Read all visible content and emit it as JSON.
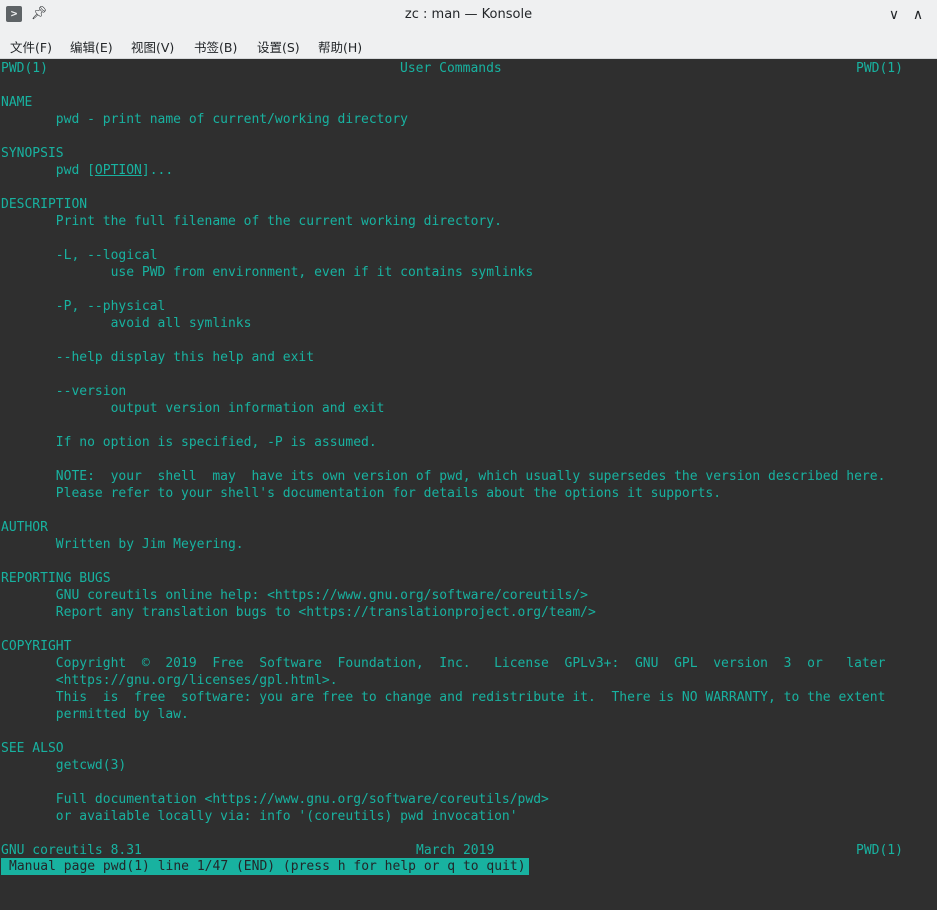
{
  "window": {
    "title": "zc : man — Konsole",
    "app_icon": "terminal-icon",
    "pin_icon": "pin-icon",
    "minimize_icon": "chevron-down-icon",
    "maximize_icon": "chevron-up-icon",
    "close_icon": "close-icon"
  },
  "menu": {
    "file": "文件(F)",
    "edit": "编辑(E)",
    "view": "视图(V)",
    "bookmarks": "书签(B)",
    "settings": "设置(S)",
    "help": "帮助(H)"
  },
  "manpage": {
    "header_left": "PWD(1)",
    "header_center": "User Commands",
    "header_right": "PWD(1)",
    "footer_left": "GNU coreutils 8.31",
    "footer_center": "March 2019",
    "footer_right": "PWD(1)",
    "status": "Manual page pwd(1) line 1/47 (END) (press h for help or q to quit)",
    "synopsis_pre": "       pwd [",
    "synopsis_opt": "OPTION",
    "synopsis_post": "]...",
    "lines": [
      "NAME",
      "       pwd - print name of current/working directory",
      "",
      "SYNOPSIS",
      "",
      "",
      "DESCRIPTION",
      "       Print the full filename of the current working directory.",
      "",
      "       -L, --logical",
      "              use PWD from environment, even if it contains symlinks",
      "",
      "       -P, --physical",
      "              avoid all symlinks",
      "",
      "       --help display this help and exit",
      "",
      "       --version",
      "              output version information and exit",
      "",
      "       If no option is specified, -P is assumed.",
      "",
      "       NOTE:  your  shell  may  have its own version of pwd, which usually supersedes the version described here.",
      "       Please refer to your shell's documentation for details about the options it supports.",
      "",
      "AUTHOR",
      "       Written by Jim Meyering.",
      "",
      "REPORTING BUGS",
      "       GNU coreutils online help: <https://www.gnu.org/software/coreutils/>",
      "       Report any translation bugs to <https://translationproject.org/team/>",
      "",
      "COPYRIGHT",
      "       Copyright  ©  2019  Free  Software  Foundation,  Inc.   License  GPLv3+:  GNU  GPL  version  3  or   later",
      "       <https://gnu.org/licenses/gpl.html>.",
      "       This  is  free  software: you are free to change and redistribute it.  There is NO WARRANTY, to the extent",
      "       permitted by law.",
      "",
      "SEE ALSO",
      "       getcwd(3)",
      "",
      "       Full documentation <https://www.gnu.org/software/coreutils/pwd>",
      "       or available locally via: info '(coreutils) pwd invocation'"
    ]
  }
}
